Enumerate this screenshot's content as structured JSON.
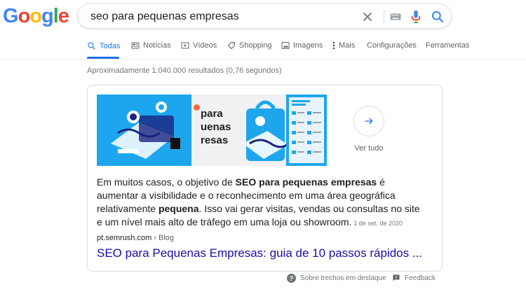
{
  "logo": {
    "text": "Google"
  },
  "search": {
    "query": "seo para pequenas empresas"
  },
  "tabs": [
    {
      "label": "Todas",
      "icon": "search-icon"
    },
    {
      "label": "Notícias",
      "icon": "newspaper-icon"
    },
    {
      "label": "Vídeos",
      "icon": "video-icon"
    },
    {
      "label": "Shopping",
      "icon": "tag-icon"
    },
    {
      "label": "Imagens",
      "icon": "image-icon"
    },
    {
      "label": "Mais",
      "icon": "more-vert-icon"
    },
    {
      "label": "Configurações"
    },
    {
      "label": "Ferramentas"
    }
  ],
  "results_stats": "Aproximadamente 1.040.000 resultados (0,76 segundos)",
  "featured": {
    "thumb_text": "para\nuenas\nresas",
    "see_all": "Ver tudo",
    "snippet_parts": [
      "Em muitos casos, o objetivo de ",
      "SEO para pequenas empresas",
      " é aumentar a visibilidade e o reconhecimento em uma área geográfica relativamente ",
      "pequena",
      ". Isso vai gerar visitas, vendas ou consultas no site e um nível mais alto de tráfego em uma loja ou showroom."
    ],
    "date": "1 de set. de 2020",
    "cite_domain": "pt.semrush.com",
    "cite_crumb": " › Blog",
    "title": "SEO para Pequenas Empresas: guia de 10 passos rápidos ..."
  },
  "footer": {
    "about": "Sobre trechos em destaque",
    "feedback": "Feedback"
  },
  "colors": {
    "accent": "#1a73e8",
    "link": "#1a0dab",
    "thumb_blue": "#1da6ee"
  }
}
